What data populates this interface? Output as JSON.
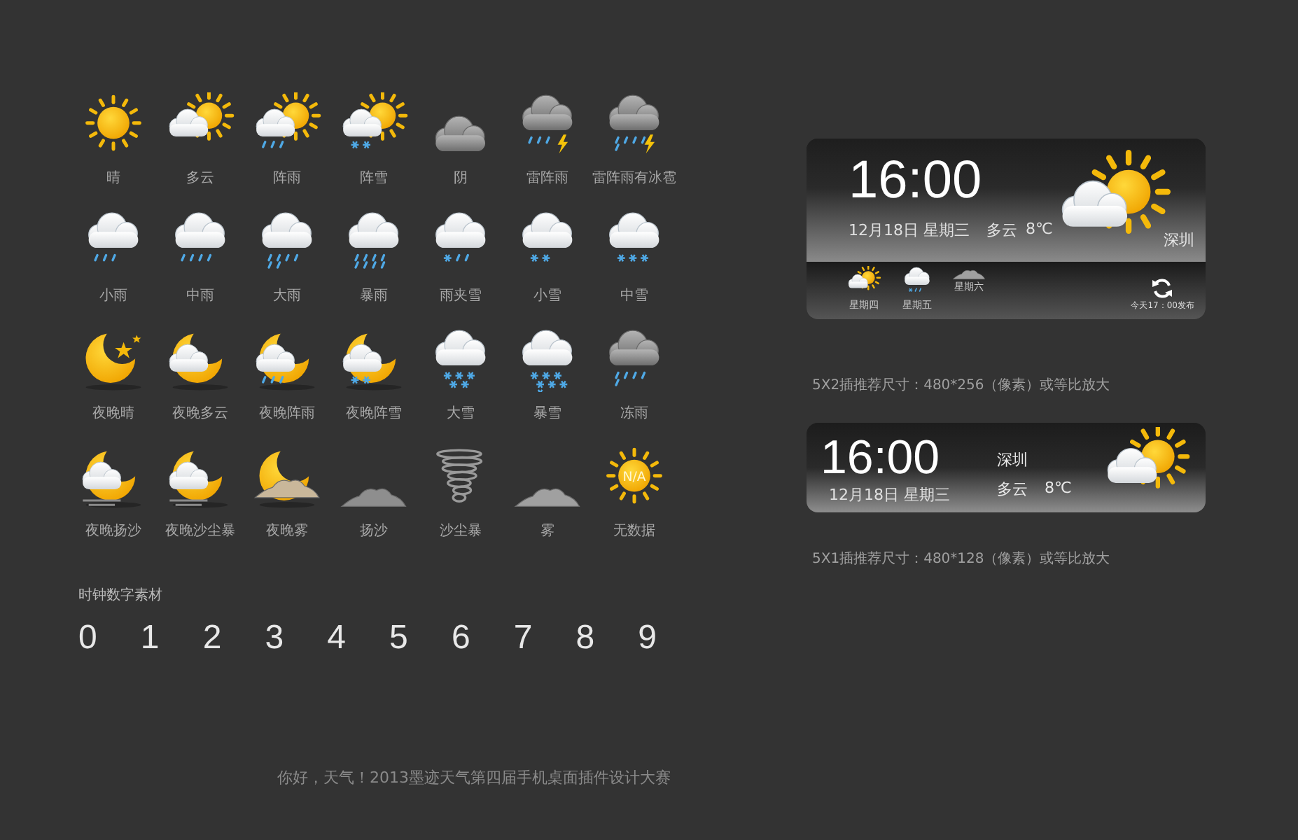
{
  "icons": [
    {
      "kind": "sunny",
      "label": "晴"
    },
    {
      "kind": "partly_cloudy",
      "label": "多云"
    },
    {
      "kind": "shower",
      "label": "阵雨"
    },
    {
      "kind": "snow_shower",
      "label": "阵雪"
    },
    {
      "kind": "overcast",
      "label": "阴"
    },
    {
      "kind": "thunder",
      "label": "雷阵雨"
    },
    {
      "kind": "thunder_hail",
      "label": "雷阵雨有冰雹"
    },
    {
      "kind": "light_rain",
      "label": "小雨"
    },
    {
      "kind": "moderate_rain",
      "label": "中雨"
    },
    {
      "kind": "heavy_rain",
      "label": "大雨"
    },
    {
      "kind": "rainstorm",
      "label": "暴雨"
    },
    {
      "kind": "sleet",
      "label": "雨夹雪"
    },
    {
      "kind": "light_snow",
      "label": "小雪"
    },
    {
      "kind": "moderate_snow",
      "label": "中雪"
    },
    {
      "kind": "night_clear",
      "label": "夜晚晴"
    },
    {
      "kind": "night_cloudy",
      "label": "夜晚多云"
    },
    {
      "kind": "night_shower",
      "label": "夜晚阵雨"
    },
    {
      "kind": "night_snow",
      "label": "夜晚阵雪"
    },
    {
      "kind": "heavy_snow",
      "label": "大雪"
    },
    {
      "kind": "blizzard",
      "label": "暴雪"
    },
    {
      "kind": "freezing_rain",
      "label": "冻雨"
    },
    {
      "kind": "night_sand",
      "label": "夜晚扬沙"
    },
    {
      "kind": "night_duststorm",
      "label": "夜晚沙尘暴"
    },
    {
      "kind": "night_fog",
      "label": "夜晚雾"
    },
    {
      "kind": "sand",
      "label": "扬沙"
    },
    {
      "kind": "duststorm",
      "label": "沙尘暴"
    },
    {
      "kind": "fog",
      "label": "雾"
    },
    {
      "kind": "na",
      "label": "无数据",
      "icon_text": "N/A"
    }
  ],
  "digits_title": "时钟数字素材",
  "digits": [
    "0",
    "1",
    "2",
    "3",
    "4",
    "5",
    "6",
    "7",
    "8",
    "9"
  ],
  "widget_large": {
    "time": "16:00",
    "date": "12月18日 星期三",
    "condition": "多云",
    "temperature": "8℃",
    "city": "深圳",
    "kind": "partly_cloudy",
    "forecast": [
      {
        "kind": "partly_cloudy",
        "day": "星期四"
      },
      {
        "kind": "sleet",
        "day": "星期五"
      },
      {
        "kind": "fog",
        "day": "星期六"
      }
    ],
    "updated": "今天17：00发布"
  },
  "caption_large": "5X2插推荐尺寸：480*256（像素）或等比放大",
  "widget_small": {
    "time": "16:00",
    "date": "12月18日 星期三",
    "city": "深圳",
    "condition": "多云",
    "temperature": "8℃",
    "kind": "partly_cloudy"
  },
  "caption_small": "5X1插推荐尺寸：480*128（像素）或等比放大",
  "footer": "你好，天气！2013墨迹天气第四届手机桌面插件设计大赛"
}
